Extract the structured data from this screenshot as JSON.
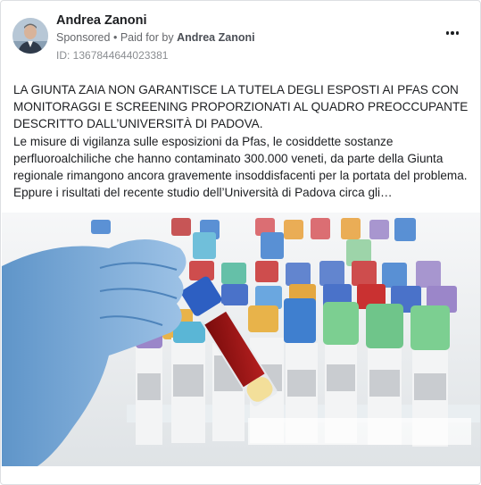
{
  "post": {
    "author": "Andrea Zanoni",
    "sponsored_label": "Sponsored",
    "paid_for_prefix": "Paid for by",
    "paid_for_name": "Andrea Zanoni",
    "ad_id": "ID: 1367844644023381",
    "headline": "LA GIUNTA ZAIA NON GARANTISCE LA TUTELA DEGLI ESPOSTI AI PFAS CON MONITORAGGI E SCREENING PROPORZIONATI AL QUADRO PREOCCUPANTE DESCRITTO DALL’UNIVERSITÀ DI PADOVA.",
    "body": "Le misure di vigilanza sulle esposizioni da Pfas, le cosiddette sostanze perfluoroalchiliche che hanno contaminato 300.000 veneti, da parte della Giunta regionale rimangono ancora gravemente insoddisfacenti per la portata del problema. Eppure i risultati del recente studio dell’Università di Padova circa gli…",
    "more_icon": "more-horizontal-icon",
    "image_subject": "gloved hand holding blood sample tube in front of rack of lab test tubes"
  }
}
